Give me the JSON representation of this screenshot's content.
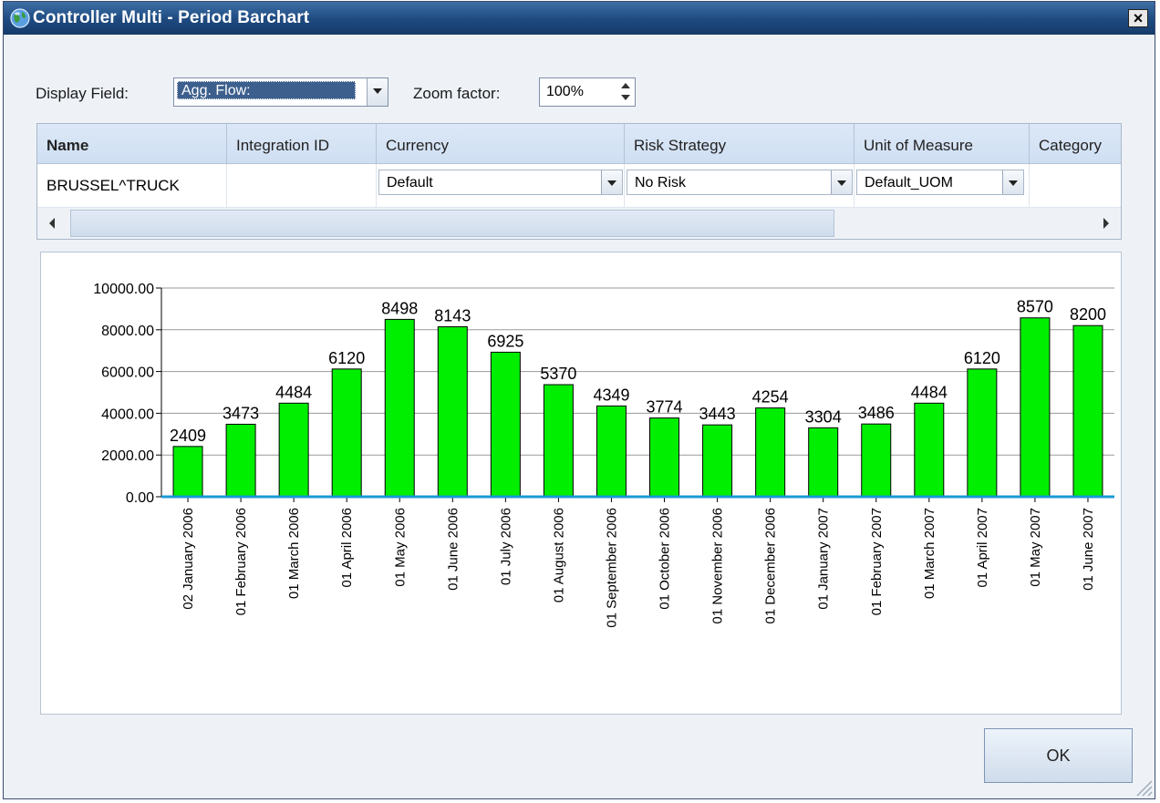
{
  "window": {
    "title": "Controller Multi - Period Barchart",
    "close_label": "×"
  },
  "toolbar": {
    "display_field_label": "Display Field:",
    "display_field_value": "Agg. Flow:",
    "zoom_label": "Zoom factor:",
    "zoom_value": "100%"
  },
  "grid": {
    "columns": [
      "Name",
      "Integration ID",
      "Currency",
      "Risk Strategy",
      "Unit of Measure",
      "Category"
    ],
    "row": {
      "name": "BRUSSEL^TRUCK",
      "integration_id": "",
      "currency": "Default",
      "risk_strategy": "No Risk",
      "unit_of_measure": "Default_UOM",
      "category": ""
    }
  },
  "chart_data": {
    "type": "bar",
    "categories": [
      "02 January 2006",
      "01 February 2006",
      "01 March 2006",
      "01 April 2006",
      "01 May 2006",
      "01 June 2006",
      "01 July 2006",
      "01 August 2006",
      "01 September 2006",
      "01 October 2006",
      "01 November 2006",
      "01 December 2006",
      "01 January 2007",
      "01 February 2007",
      "01 March 2007",
      "01 April 2007",
      "01 May 2007",
      "01 June 2007"
    ],
    "values": [
      2409,
      3473,
      4484,
      6120,
      8498,
      8143,
      6925,
      5370,
      4349,
      3774,
      3443,
      4254,
      3304,
      3486,
      4484,
      6120,
      8570,
      8200
    ],
    "yticks": [
      "0.00",
      "2000.00",
      "4000.00",
      "6000.00",
      "8000.00",
      "10000.00"
    ],
    "ylim": [
      0,
      10000
    ],
    "grid": true,
    "bar_color": "#00ee00",
    "axis_color": "#1a9ad6"
  },
  "buttons": {
    "ok_label": "OK"
  },
  "colors": {
    "titlebar": "#1e4a80",
    "window_bg": "#eef2f7"
  },
  "icons": {
    "title": "globe-icon"
  }
}
